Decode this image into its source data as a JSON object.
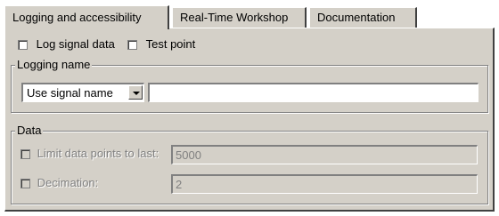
{
  "tabs": [
    {
      "label": "Logging and accessibility",
      "active": true
    },
    {
      "label": "Real-Time Workshop",
      "active": false
    },
    {
      "label": "Documentation",
      "active": false
    }
  ],
  "options": {
    "log_signal_data": {
      "label": "Log signal data",
      "checked": false
    },
    "test_point": {
      "label": "Test point",
      "checked": false
    }
  },
  "logging_name": {
    "title": "Logging name",
    "select_value": "Use signal name",
    "input_value": ""
  },
  "data_group": {
    "title": "Data",
    "limit": {
      "label": "Limit data points to last:",
      "checked": false,
      "enabled": false,
      "value": "5000"
    },
    "decimation": {
      "label": "Decimation:",
      "checked": false,
      "enabled": false,
      "value": "2"
    }
  },
  "colors": {
    "face": "#d4d0c8",
    "shadow": "#808080",
    "dark_shadow": "#404040",
    "highlight": "#ffffff"
  },
  "icons": {
    "dropdown": "chevron-down-icon"
  }
}
